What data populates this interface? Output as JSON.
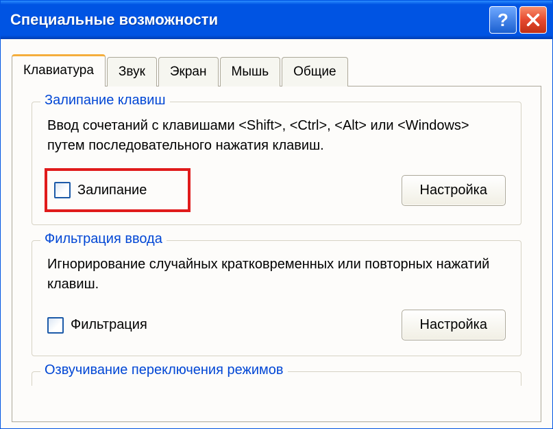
{
  "window": {
    "title": "Специальные возможности"
  },
  "tabs": [
    {
      "label": "Клавиатура"
    },
    {
      "label": "Звук"
    },
    {
      "label": "Экран"
    },
    {
      "label": "Мышь"
    },
    {
      "label": "Общие"
    }
  ],
  "sticky": {
    "title": "Залипание клавиш",
    "desc": "Ввод сочетаний с клавишами <Shift>, <Ctrl>, <Alt> или <Windows> путем последовательного нажатия клавиш.",
    "checkbox_label": "Залипание",
    "settings_btn": "Настройка"
  },
  "filter": {
    "title": "Фильтрация ввода",
    "desc": "Игнорирование случайных кратковременных или повторных нажатий клавиш.",
    "checkbox_label": "Фильтрация",
    "settings_btn": "Настройка"
  },
  "voice": {
    "title": "Озвучивание переключения режимов"
  }
}
